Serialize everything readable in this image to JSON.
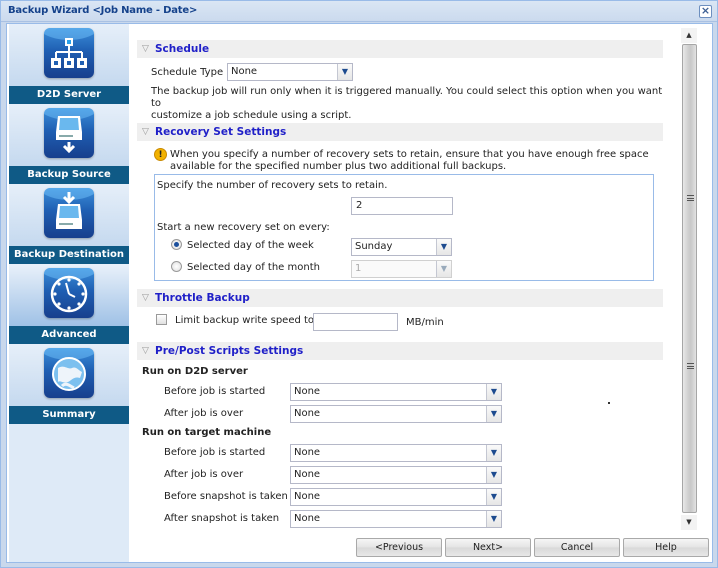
{
  "window": {
    "title": "Backup Wizard <Job Name - Date>",
    "close_icon": "close-x"
  },
  "sidebar": {
    "items": [
      {
        "label": "D2D Server",
        "icon": "network-hierarchy-icon",
        "active": false
      },
      {
        "label": "Backup Source",
        "icon": "drive-arrow-down-icon",
        "active": false
      },
      {
        "label": "Backup Destination",
        "icon": "drive-arrow-in-icon",
        "active": false
      },
      {
        "label": "Advanced",
        "icon": "clock-icon",
        "active": true
      },
      {
        "label": "Summary",
        "icon": "globe-icon",
        "active": false
      }
    ]
  },
  "schedule": {
    "header": "Schedule",
    "type_label": "Schedule Type",
    "type_value": "None",
    "description_line1": "The backup job will run only when it is triggered manually. You could select this option when you want to",
    "description_line2": "customize a job schedule using a script."
  },
  "recovery": {
    "header": "Recovery Set Settings",
    "warning_line1": "When you specify a number of recovery sets to retain, ensure that you have enough free space",
    "warning_line2": "available for the specified number plus two additional full backups.",
    "retain_label": "Specify the number of recovery sets to retain.",
    "retain_value": "2",
    "start_label": "Start a new recovery set on every:",
    "week_option": {
      "label": "Selected day of the week",
      "checked": true,
      "value": "Sunday"
    },
    "month_option": {
      "label": "Selected day of the month",
      "checked": false,
      "value": "1"
    }
  },
  "throttle": {
    "header": "Throttle Backup",
    "checkbox_label": "Limit backup write speed to",
    "checked": false,
    "value": "",
    "unit": "MB/min"
  },
  "scripts": {
    "header": "Pre/Post Scripts Settings",
    "d2d_heading": "Run on D2D server",
    "d2d": [
      {
        "label": "Before job is started",
        "value": "None"
      },
      {
        "label": "After job is over",
        "value": "None"
      }
    ],
    "target_heading": "Run on target machine",
    "target": [
      {
        "label": "Before job is started",
        "value": "None"
      },
      {
        "label": "After job is over",
        "value": "None"
      },
      {
        "label": "Before snapshot is taken",
        "value": "None"
      },
      {
        "label": "After snapshot is taken",
        "value": "None"
      }
    ]
  },
  "footer": {
    "previous": "<Previous",
    "next": "Next>",
    "cancel": "Cancel",
    "help": "Help"
  }
}
